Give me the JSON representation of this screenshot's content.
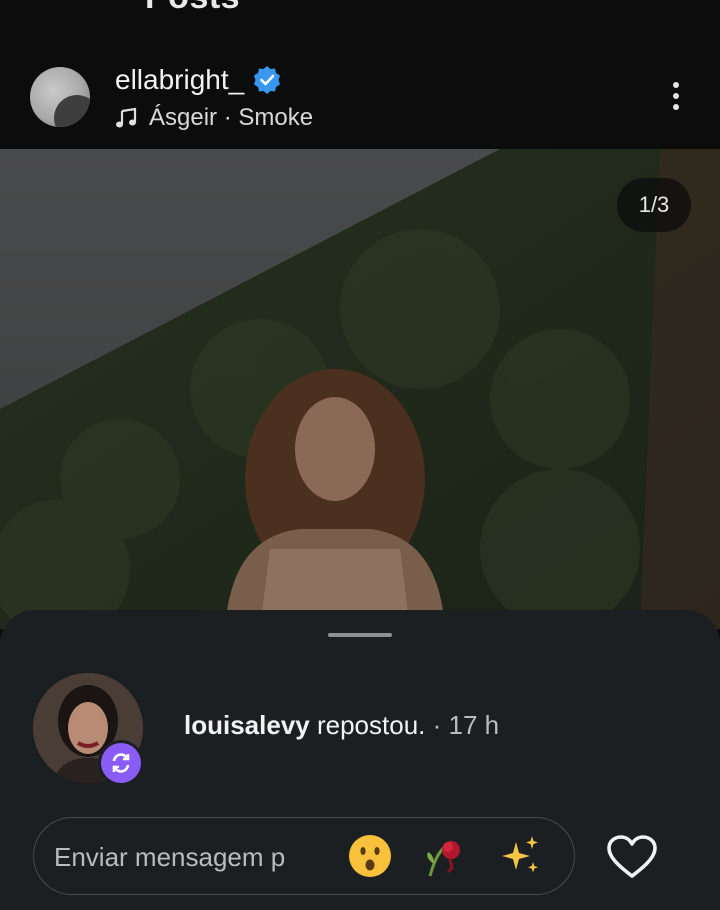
{
  "header": {
    "title": "Posts"
  },
  "post": {
    "username": "ellabright_",
    "verified": true,
    "song": "Ásgeir · Smoke",
    "photo_counter": "1/3"
  },
  "repost": {
    "username": "louisalevy",
    "action": "repostou.",
    "separator": " · ",
    "time": "17 h"
  },
  "message": {
    "placeholder": "Enviar mensagem p",
    "emojis": [
      "surprised-face",
      "wilted-flower",
      "sparkles"
    ]
  },
  "colors": {
    "verified": "#3897f0",
    "repost_badge": "#8a5cf6",
    "sheet": "#1c1f22"
  }
}
